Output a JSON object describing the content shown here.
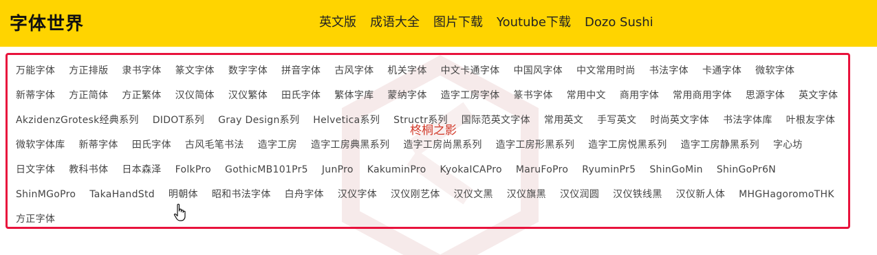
{
  "header": {
    "logo": "字体世界",
    "nav": [
      "英文版",
      "成语大全",
      "图片下载",
      "Youtube下载",
      "Dozo Sushi"
    ]
  },
  "tags": [
    "万能字体",
    "方正排版",
    "隶书字体",
    "篆文字体",
    "数字字体",
    "拼音字体",
    "古风字体",
    "机关字体",
    "中文卡通字体",
    "中国风字体",
    "中文常用时尚",
    "书法字体",
    "卡通字体",
    "微软字体",
    "新蒂字体",
    "方正简体",
    "方正繁体",
    "汉仪简体",
    "汉仪繁体",
    "田氏字体",
    "繁体字库",
    "蒙纳字体",
    "造字工房字体",
    "篆书字体",
    "常用中文",
    "商用字体",
    "常用商用字体",
    "思源字体",
    "英文字体",
    "AkzidenzGrotesk经典系列",
    "DIDOT系列",
    "Gray Design系列",
    "Helvetica系列",
    "Structr系列",
    "国际范英文字体",
    "常用英文",
    "手写英文",
    "时尚英文字体",
    "书法字体库",
    "叶根友字体",
    "微软字体库",
    "新蒂字体",
    "田氏字体",
    "古风毛笔书法",
    "造字工房",
    "造字工房典黑系列",
    "造字工房尚黑系列",
    "造字工房形黑系列",
    "造字工房悦黑系列",
    "造字工房静黑系列",
    "字心坊",
    "日文字体",
    "教科书体",
    "日本森泽",
    "FolkPro",
    "GothicMB101Pr5",
    "JunPro",
    "KakuminPro",
    "KyokaICAPro",
    "MaruFoPro",
    "RyuminPr5",
    "ShinGoMin",
    "ShinGoPr6N",
    "ShinMGoPro",
    "TakaHandStd",
    "明朝体",
    "昭和书法字体",
    "白舟字体",
    "汉仪字体",
    "汉仪刚艺体",
    "汉仪文黑",
    "汉仪旗黑",
    "汉仪润圆",
    "汉仪铁线黑",
    "汉仪新人体",
    "MHGHagoromoTHK",
    "方正字体"
  ],
  "overlay_text": "柊桐之影",
  "colors": {
    "header_bg": "#FFD400",
    "panel_border": "#E8123C",
    "tag_text": "#444444",
    "overlay_text": "#D23A2A"
  },
  "icons": {
    "cursor": "hand-pointer-icon",
    "watermark": "seal-watermark"
  }
}
